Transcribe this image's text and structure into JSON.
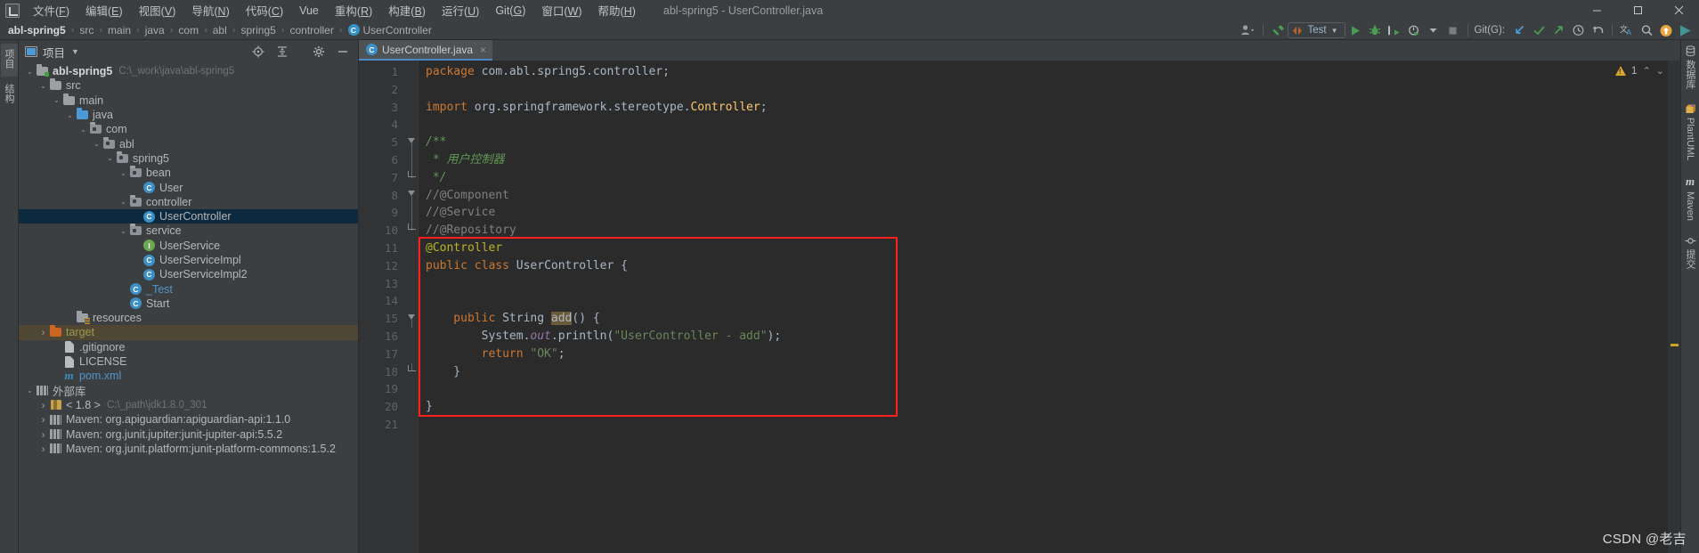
{
  "window": {
    "title": "abl-spring5 - UserController.java",
    "controls": {
      "minimize": "minimize-icon",
      "maximize": "maximize-icon",
      "close": "close-icon"
    }
  },
  "menubar": {
    "logo": "intellij-idea-logo",
    "items": [
      {
        "label": "文件",
        "mnemonic": "(F)"
      },
      {
        "label": "编辑",
        "mnemonic": "(E)"
      },
      {
        "label": "视图",
        "mnemonic": "(V)"
      },
      {
        "label": "导航",
        "mnemonic": "(N)"
      },
      {
        "label": "代码",
        "mnemonic": "(C)"
      },
      {
        "label": "Vue",
        "mnemonic": ""
      },
      {
        "label": "重构",
        "mnemonic": "(R)"
      },
      {
        "label": "构建",
        "mnemonic": "(B)"
      },
      {
        "label": "运行",
        "mnemonic": "(U)"
      },
      {
        "label": "Git",
        "mnemonic": "(G)"
      },
      {
        "label": "窗口",
        "mnemonic": "(W)"
      },
      {
        "label": "帮助",
        "mnemonic": "(H)"
      }
    ]
  },
  "breadcrumb": {
    "items": [
      "abl-spring5",
      "src",
      "main",
      "java",
      "com",
      "abl",
      "spring5",
      "controller"
    ],
    "separator": "›",
    "leaf": {
      "label": "UserController",
      "icon": "class-icon",
      "badge": "C"
    }
  },
  "toolbar": {
    "avatar": "user-avatar-icon",
    "hammer": "build-hammer-icon",
    "run_config": {
      "label": "Test",
      "icon": "run-config-icon",
      "caret": "▼"
    },
    "run": "run-icon",
    "debug": "debug-icon",
    "run_coverage": "run-with-coverage-icon",
    "profiler": "profiler-icon",
    "stop": "stop-icon",
    "git_label": "Git(G):",
    "git_update": "update-project-icon",
    "git_commit": "commit-icon",
    "git_push": "push-icon",
    "git_history": "history-icon",
    "git_rollback": "rollback-icon",
    "translate": "translate-icon",
    "search": "search-everywhere-icon",
    "upload": "upload-icon",
    "play_colored": "run-anything-icon"
  },
  "left_rail": {
    "items": [
      {
        "label": "项目",
        "icon": "project-tool-icon"
      },
      {
        "label": "结构",
        "icon": "structure-tool-icon"
      }
    ]
  },
  "project_panel": {
    "title": "项目",
    "caret": "▼",
    "actions": [
      {
        "name": "select-opened-file-icon"
      },
      {
        "name": "collapse-all-icon"
      },
      {
        "name": "settings-gear-icon"
      },
      {
        "name": "hide-panel-icon"
      }
    ],
    "tree": [
      {
        "depth": 0,
        "arrow": "v",
        "icon": "folder-module",
        "label": "abl-spring5",
        "style": "bold",
        "path": "C:\\_work\\java\\abl-spring5"
      },
      {
        "depth": 1,
        "arrow": "v",
        "icon": "folder",
        "label": "src"
      },
      {
        "depth": 2,
        "arrow": "v",
        "icon": "folder",
        "label": "main"
      },
      {
        "depth": 3,
        "arrow": "v",
        "icon": "folder-source",
        "label": "java"
      },
      {
        "depth": 4,
        "arrow": "v",
        "icon": "folder-package",
        "label": "com"
      },
      {
        "depth": 5,
        "arrow": "v",
        "icon": "folder-package",
        "label": "abl"
      },
      {
        "depth": 6,
        "arrow": "v",
        "icon": "folder-package",
        "label": "spring5"
      },
      {
        "depth": 7,
        "arrow": "v",
        "icon": "folder-package",
        "label": "bean"
      },
      {
        "depth": 8,
        "arrow": "",
        "icon": "class",
        "label": "User"
      },
      {
        "depth": 7,
        "arrow": "v",
        "icon": "folder-package",
        "label": "controller"
      },
      {
        "depth": 8,
        "arrow": "",
        "icon": "class",
        "label": "UserController",
        "selected": true
      },
      {
        "depth": 7,
        "arrow": "v",
        "icon": "folder-package",
        "label": "service"
      },
      {
        "depth": 8,
        "arrow": "",
        "icon": "interface",
        "label": "UserService"
      },
      {
        "depth": 8,
        "arrow": "",
        "icon": "class",
        "label": "UserServiceImpl"
      },
      {
        "depth": 8,
        "arrow": "",
        "icon": "class",
        "label": "UserServiceImpl2"
      },
      {
        "depth": 7,
        "arrow": "",
        "icon": "class-run",
        "label": "_Test",
        "style": "blue"
      },
      {
        "depth": 7,
        "arrow": "",
        "icon": "class",
        "label": "Start"
      },
      {
        "depth": 3,
        "arrow": "",
        "icon": "folder-resources",
        "label": "resources"
      },
      {
        "depth": 1,
        "arrow": ">",
        "icon": "folder-excluded",
        "label": "target",
        "style": "orange",
        "highlight": true
      },
      {
        "depth": 2,
        "arrow": "",
        "icon": "file-gitignore",
        "label": ".gitignore"
      },
      {
        "depth": 2,
        "arrow": "",
        "icon": "file-text",
        "label": "LICENSE"
      },
      {
        "depth": 2,
        "arrow": "",
        "icon": "file-maven",
        "label": "pom.xml",
        "style": "blue"
      },
      {
        "depth": 0,
        "arrow": "v",
        "icon": "external-libs",
        "label": "外部库"
      },
      {
        "depth": 1,
        "arrow": ">",
        "icon": "jdk",
        "label": "< 1.8 >",
        "path": "C:\\_path\\jdk1.8.0_301"
      },
      {
        "depth": 1,
        "arrow": ">",
        "icon": "library",
        "label": "Maven: org.apiguardian:apiguardian-api:1.1.0"
      },
      {
        "depth": 1,
        "arrow": ">",
        "icon": "library",
        "label": "Maven: org.junit.jupiter:junit-jupiter-api:5.5.2"
      },
      {
        "depth": 1,
        "arrow": ">",
        "icon": "library",
        "label": "Maven: org.junit.platform:junit-platform-commons:1.5.2"
      }
    ]
  },
  "editor": {
    "tab": {
      "label": "UserController.java",
      "icon": "java-class-icon",
      "badge": "C",
      "close": "×"
    },
    "inspection": {
      "warn_count": "1",
      "up": "⌃",
      "down": "⌄"
    },
    "first_line": 1,
    "last_line": 21,
    "lines": [
      {
        "n": 1,
        "tokens": [
          {
            "t": "package ",
            "c": "kw"
          },
          {
            "t": "com.abl.spring5.controller;",
            "c": "id"
          }
        ],
        "indent": 0
      },
      {
        "n": 2,
        "tokens": [],
        "indent": 0
      },
      {
        "n": 3,
        "tokens": [
          {
            "t": "import ",
            "c": "kw"
          },
          {
            "t": "org.springframework.stereotype.",
            "c": "id"
          },
          {
            "t": "Controller",
            "c": "cls"
          },
          {
            "t": ";",
            "c": "id"
          }
        ],
        "indent": 0
      },
      {
        "n": 4,
        "tokens": [],
        "indent": 0
      },
      {
        "n": 5,
        "tokens": [
          {
            "t": "/**",
            "c": "cmt"
          }
        ],
        "indent": 0,
        "fold": "minus"
      },
      {
        "n": 6,
        "tokens": [
          {
            "t": " * 用户控制器",
            "c": "cmt"
          }
        ],
        "indent": 0,
        "fold": "bar"
      },
      {
        "n": 7,
        "tokens": [
          {
            "t": " */",
            "c": "cmt"
          }
        ],
        "indent": 0,
        "fold": "end"
      },
      {
        "n": 8,
        "tokens": [
          {
            "t": "//@Component",
            "c": "cmt2"
          }
        ],
        "indent": 0,
        "fold": "minus"
      },
      {
        "n": 9,
        "tokens": [
          {
            "t": "//@Service",
            "c": "cmt2"
          }
        ],
        "indent": 0,
        "fold": "bar"
      },
      {
        "n": 10,
        "tokens": [
          {
            "t": "//@Repository",
            "c": "cmt2"
          }
        ],
        "indent": 0,
        "fold": "end"
      },
      {
        "n": 11,
        "tokens": [
          {
            "t": "@Controller",
            "c": "anno"
          }
        ],
        "indent": 0
      },
      {
        "n": 12,
        "tokens": [
          {
            "t": "public ",
            "c": "kw"
          },
          {
            "t": "class ",
            "c": "kw"
          },
          {
            "t": "UserController",
            "c": "id"
          },
          {
            "t": " {",
            "c": "id"
          }
        ],
        "indent": 0
      },
      {
        "n": 13,
        "tokens": [],
        "indent": 0
      },
      {
        "n": 14,
        "tokens": [],
        "indent": 0
      },
      {
        "n": 15,
        "tokens": [
          {
            "t": "    public ",
            "c": "kw"
          },
          {
            "t": "String ",
            "c": "id"
          },
          {
            "t": "add",
            "c": "hlsel"
          },
          {
            "t": "() {",
            "c": "id"
          }
        ],
        "indent": 0,
        "fold": "minus"
      },
      {
        "n": 16,
        "tokens": [
          {
            "t": "        System.",
            "c": "id"
          },
          {
            "t": "out",
            "c": "fld"
          },
          {
            "t": ".println(",
            "c": "id"
          },
          {
            "t": "\"UserController - add\"",
            "c": "str"
          },
          {
            "t": ");",
            "c": "id"
          }
        ],
        "indent": 0
      },
      {
        "n": 17,
        "tokens": [
          {
            "t": "        return ",
            "c": "kw"
          },
          {
            "t": "\"OK\"",
            "c": "str"
          },
          {
            "t": ";",
            "c": "id"
          }
        ],
        "indent": 0
      },
      {
        "n": 18,
        "tokens": [
          {
            "t": "    }",
            "c": "id"
          }
        ],
        "indent": 0,
        "fold": "end"
      },
      {
        "n": 19,
        "tokens": [],
        "indent": 0
      },
      {
        "n": 20,
        "tokens": [
          {
            "t": "}",
            "c": "id"
          }
        ],
        "indent": 0
      },
      {
        "n": 21,
        "tokens": [],
        "indent": 0
      }
    ],
    "annotation_box": {
      "color": "#ff2020",
      "from_line": 11,
      "to_line": 20
    }
  },
  "right_rail": {
    "items": [
      {
        "label": "数据库",
        "icon": "database-icon"
      },
      {
        "label": "PlantUML",
        "icon": "plantuml-icon"
      },
      {
        "label": "Maven",
        "icon": "maven-icon"
      },
      {
        "label": "提交",
        "icon": "commit-icon"
      }
    ]
  },
  "watermark": "CSDN @老吉",
  "colors": {
    "accent": "#4a88c7",
    "annotation": "#ff2020",
    "selection": "#0d293e",
    "highlight": "#4f4733",
    "editor_bg": "#2b2b2b",
    "panel_bg": "#3c3f41"
  }
}
